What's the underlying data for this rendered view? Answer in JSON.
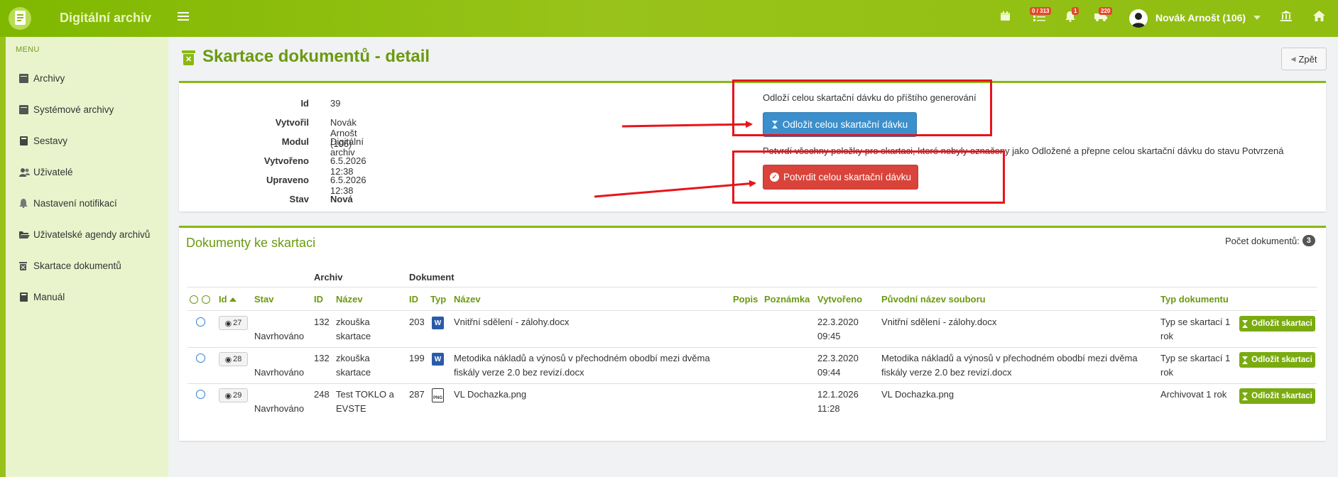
{
  "app": {
    "title": "Digitální archiv"
  },
  "topbar": {
    "badge_tasks": "0 / 313",
    "badge_notifications": "1",
    "badge_transfers": "220",
    "user_name": "Novák Arnošt (106)"
  },
  "sidebar": {
    "caption": "MENU",
    "items": [
      {
        "label": "Archivy",
        "icon": "archive-icon"
      },
      {
        "label": "Systémové archivy",
        "icon": "archive-icon"
      },
      {
        "label": "Sestavy",
        "icon": "book-icon"
      },
      {
        "label": "Uživatelé",
        "icon": "users-icon"
      },
      {
        "label": "Nastavení notifikací",
        "icon": "bell-icon"
      },
      {
        "label": "Uživatelské agendy archivů",
        "icon": "folder-icon"
      },
      {
        "label": "Skartace dokumentů",
        "icon": "trash-icon"
      },
      {
        "label": "Manuál",
        "icon": "book-icon"
      }
    ]
  },
  "page": {
    "title": "Skartace dokumentů - detail",
    "back_label": "Zpět"
  },
  "detail": {
    "rows": [
      {
        "key": "Id",
        "value": "39"
      },
      {
        "key": "Vytvořil",
        "value": "Novák Arnošt (106)"
      },
      {
        "key": "Modul",
        "value": "Digitální archiv"
      },
      {
        "key": "Vytvořeno",
        "value": "6.5.2026 12:38"
      },
      {
        "key": "Upraveno",
        "value": "6.5.2026 12:38"
      },
      {
        "key": "Stav",
        "value": "Nová"
      }
    ],
    "postpone_hint": "Odloží celou skartační dávku do příštího generování",
    "postpone_button": "Odložit celou skartační dávku",
    "confirm_hint": "Potvrdí všechny položky pro skartaci, které nebyly označeny jako Odložené a přepne celou skartační dávku do stavu Potvrzená",
    "confirm_button": "Potvrdit celou skartační dávku"
  },
  "documents": {
    "title": "Dokumenty ke skartaci",
    "count_label": "Počet dokumentů:",
    "count": "3",
    "group_archive": "Archiv",
    "group_document": "Dokument",
    "columns": {
      "id": "Id",
      "stav": "Stav",
      "archive_id": "ID",
      "archive_name": "Název",
      "doc_id": "ID",
      "typ": "Typ",
      "doc_name": "Název",
      "popis": "Popis",
      "poznamka": "Poznámka",
      "vytvoreno": "Vytvořeno",
      "puvodni": "Původní název souboru",
      "typ_dokumentu": "Typ dokumentu"
    },
    "rows": [
      {
        "id": "27",
        "stav": "Navrhováno",
        "archive_id": "132",
        "archive_name_1": "zkouška",
        "archive_name_2": "skartace",
        "doc_id": "203",
        "file_type": "docx",
        "doc_name_1": "Vnitřní sdělení - zálohy.docx",
        "doc_name_2": "",
        "created_date": "22.3.2020",
        "created_time": "09:45",
        "orig_1": "Vnitřní sdělení - zálohy.docx",
        "orig_2": "",
        "doc_type_1": "Typ se skartací 1",
        "doc_type_2": "rok",
        "action": "Odložit skartaci"
      },
      {
        "id": "28",
        "stav": "Navrhováno",
        "archive_id": "132",
        "archive_name_1": "zkouška",
        "archive_name_2": "skartace",
        "doc_id": "199",
        "file_type": "docx",
        "doc_name_1": "Metodika nákladů a výnosů v přechodném obodbí mezi dvěma",
        "doc_name_2": "fiskály verze 2.0 bez revizí.docx",
        "created_date": "22.3.2020",
        "created_time": "09:44",
        "orig_1": "Metodika nákladů a výnosů v přechodném obodbí mezi dvěma",
        "orig_2": "fiskály verze 2.0 bez revizí.docx",
        "doc_type_1": "Typ se skartací 1",
        "doc_type_2": "rok",
        "action": "Odložit skartaci"
      },
      {
        "id": "29",
        "stav": "Navrhováno",
        "archive_id": "248",
        "archive_name_1": "Test TOKLO a",
        "archive_name_2": "EVSTE",
        "doc_id": "287",
        "file_type": "png",
        "doc_name_1": "VL Dochazka.png",
        "doc_name_2": "",
        "created_date": "12.1.2026",
        "created_time": "11:28",
        "orig_1": "VL Dochazka.png",
        "orig_2": "",
        "doc_type_1": "Archivovat 1 rok",
        "doc_type_2": "",
        "action": "Odložit skartaci"
      }
    ]
  },
  "colors": {
    "brand": "#8ab813",
    "annotation": "#e8141b",
    "primary": "#3a8fcc",
    "danger": "#d9433a"
  }
}
